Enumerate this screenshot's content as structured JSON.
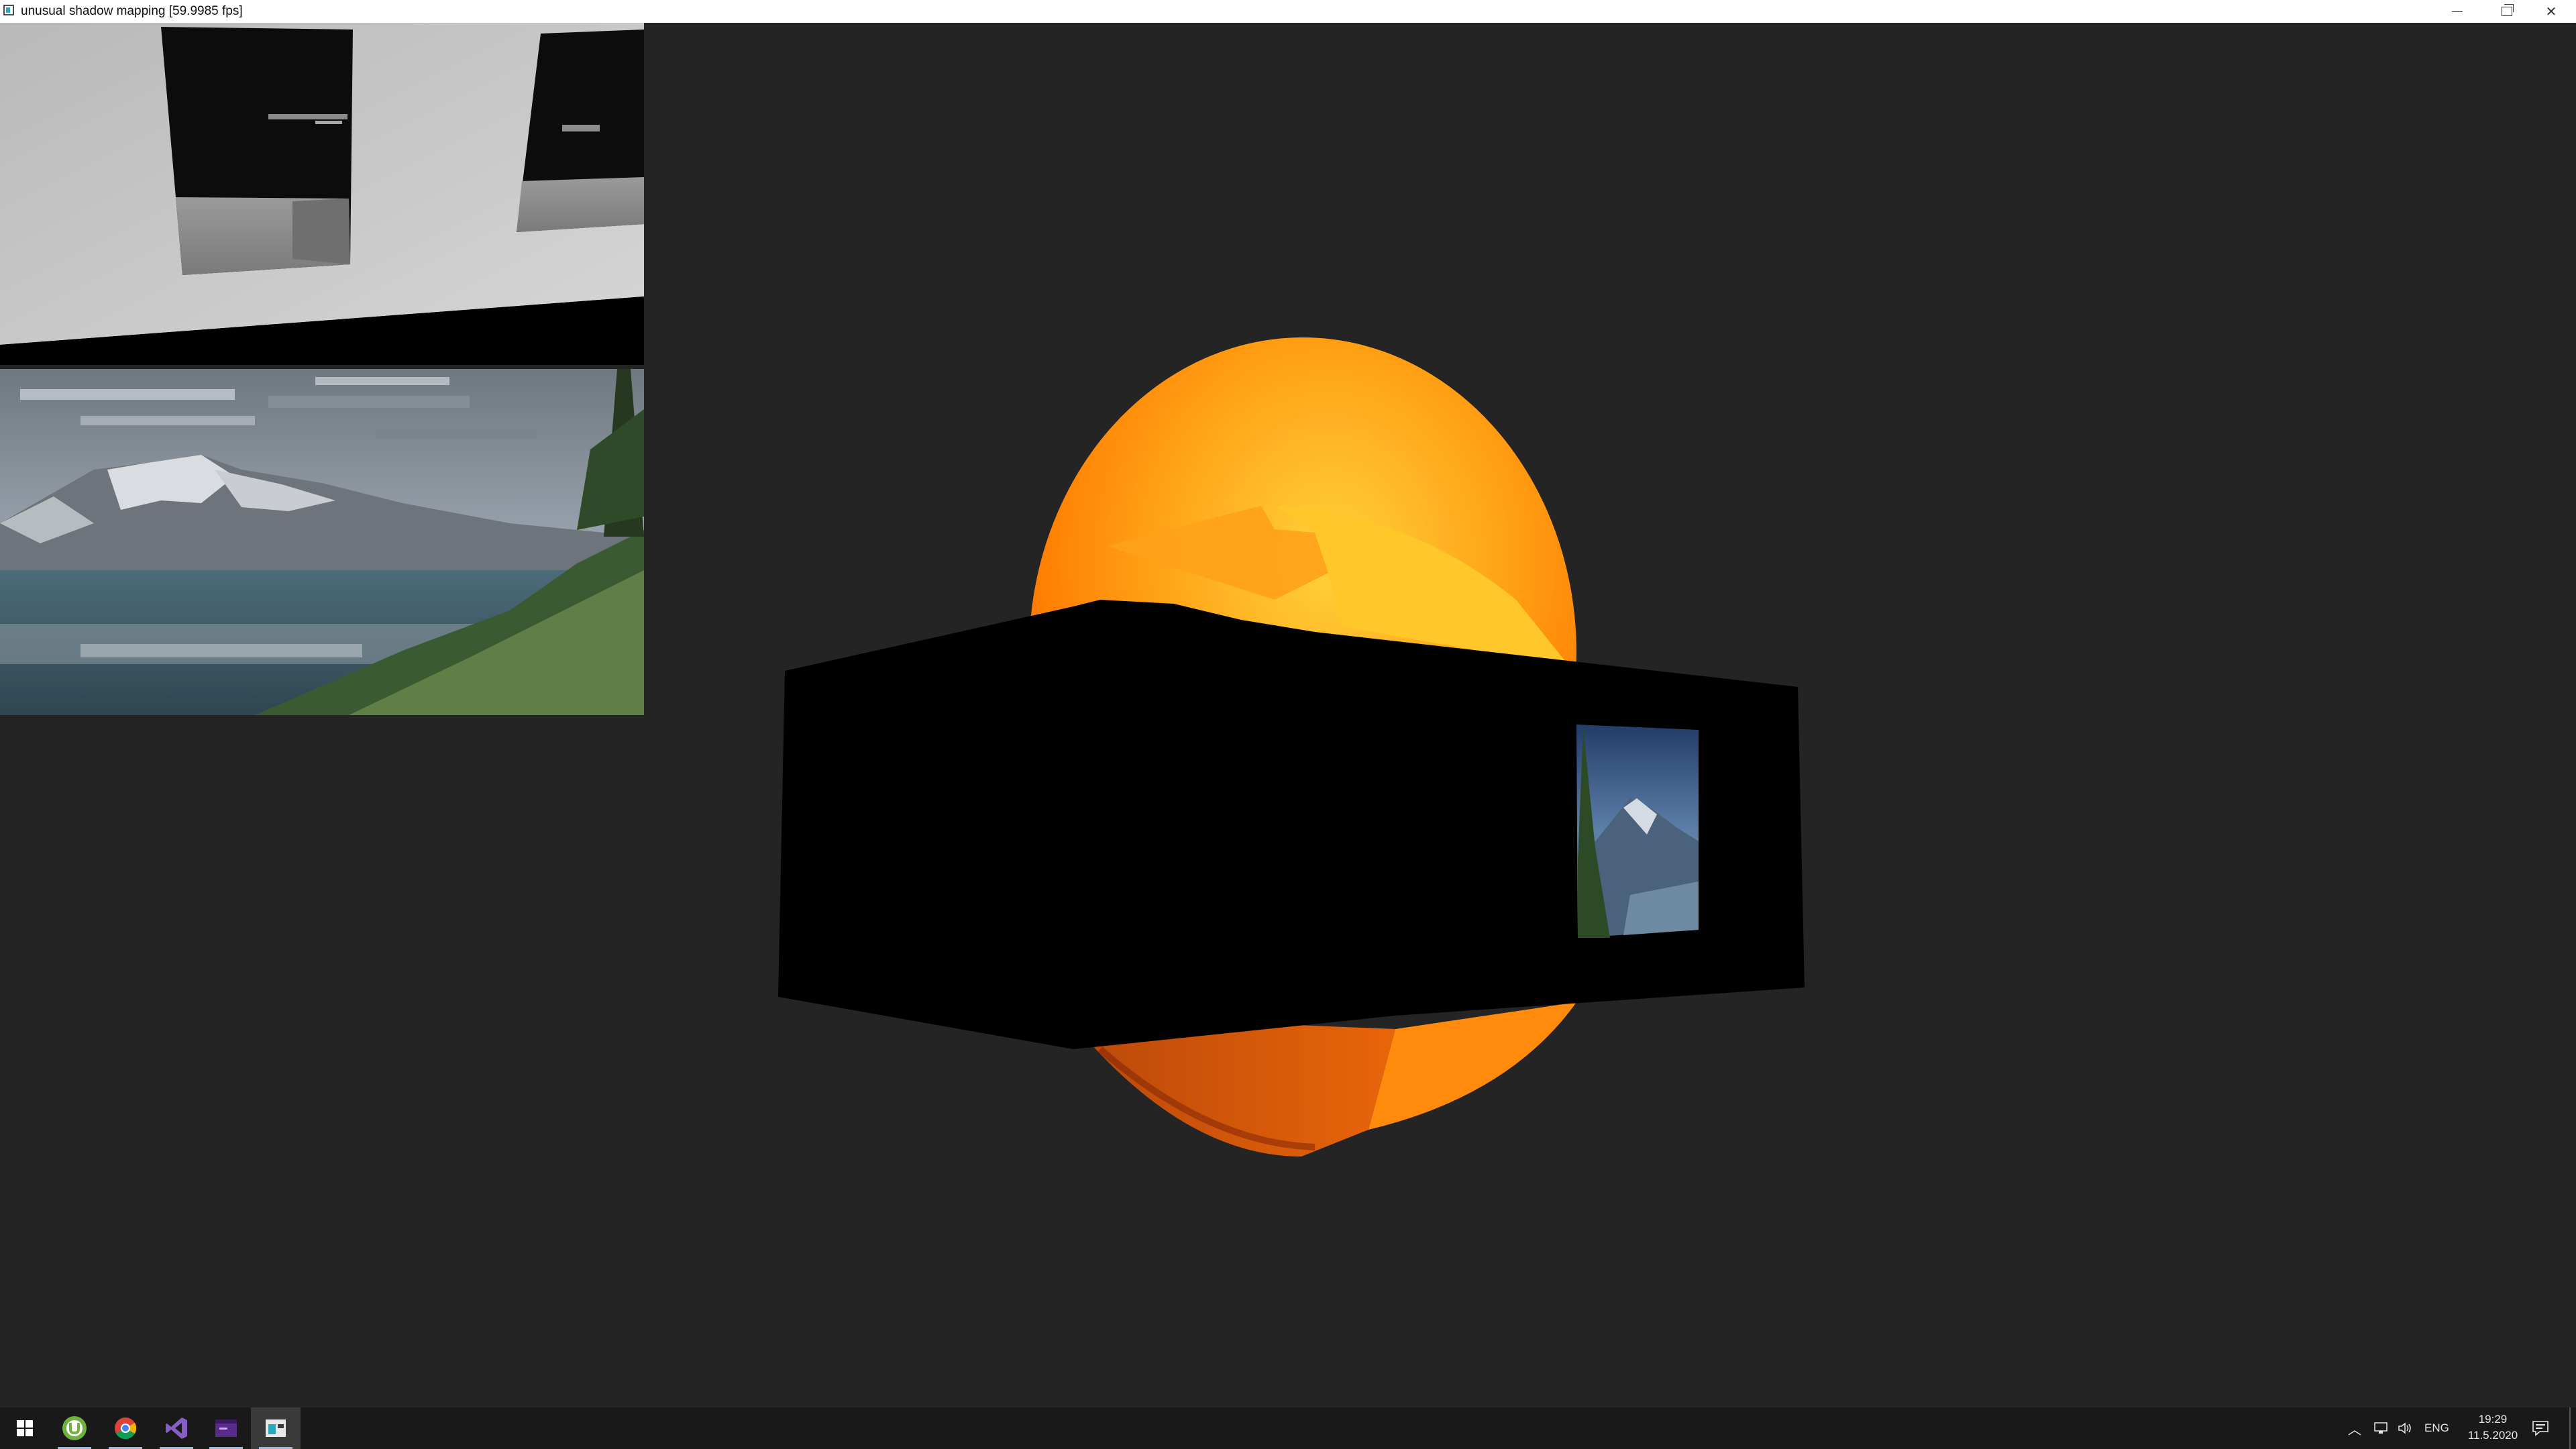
{
  "window": {
    "title": "unusual shadow mapping [59.9985 fps]",
    "controls": [
      "minimize",
      "restore",
      "close"
    ]
  },
  "viewport": {
    "background": "#242424",
    "debug_panels": [
      {
        "name": "shadow-depth-map-view",
        "kind": "grayscale depth render"
      },
      {
        "name": "mountain-texture-view",
        "kind": "mountain landscape texture"
      }
    ],
    "scene": {
      "objects": [
        {
          "name": "lava-sphere",
          "colors": [
            "#ffc21a",
            "#ff7a00",
            "#c43a06",
            "#8a1f05"
          ]
        },
        {
          "name": "dark-box",
          "color": "#000000"
        },
        {
          "name": "mountain-picture-decal",
          "kind": "mountain photo texture"
        }
      ]
    }
  },
  "taskbar": {
    "apps": [
      {
        "name": "start",
        "icon": "windows-logo-icon"
      },
      {
        "name": "utorrent",
        "icon": "utorrent-icon"
      },
      {
        "name": "chrome",
        "icon": "chrome-icon"
      },
      {
        "name": "visual-studio",
        "icon": "visual-studio-icon"
      },
      {
        "name": "render-app",
        "icon": "purple-window-icon"
      },
      {
        "name": "shadow-mapping-app",
        "icon": "app-window-icon",
        "active": true
      }
    ],
    "tray": {
      "language": "ENG",
      "time": "19:29",
      "date": "11.5.2020"
    }
  }
}
